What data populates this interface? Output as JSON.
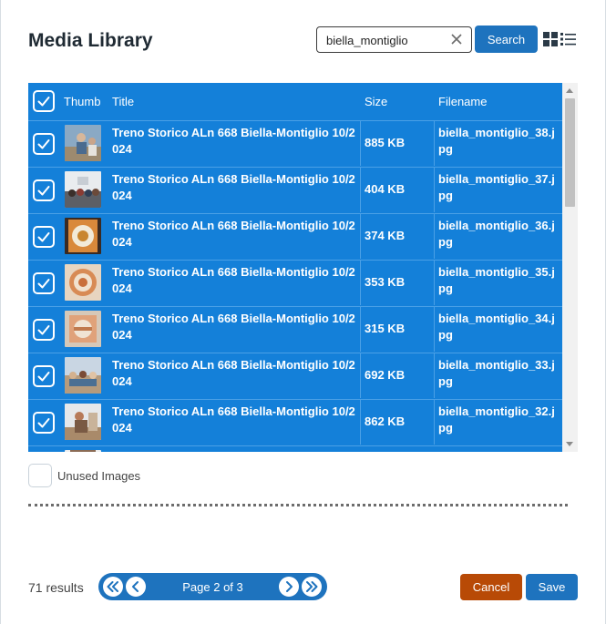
{
  "dialog": {
    "title": "Media Library"
  },
  "search": {
    "value": "biella_montiglio",
    "button_label": "Search"
  },
  "view_toggle": {
    "grid_icon": "grid-view-icon",
    "list_icon": "list-view-icon"
  },
  "table": {
    "columns": {
      "thumb": "Thumb",
      "title": "Title",
      "size": "Size",
      "filename": "Filename"
    },
    "select_all_checked": true,
    "rows": [
      {
        "checked": true,
        "title": "Treno Storico ALn 668 Biella-Montiglio 10/2024",
        "size": "885 KB",
        "filename": "biella_montiglio_38.jpg"
      },
      {
        "checked": true,
        "title": "Treno Storico ALn 668 Biella-Montiglio 10/2024",
        "size": "404 KB",
        "filename": "biella_montiglio_37.jpg"
      },
      {
        "checked": true,
        "title": "Treno Storico ALn 668 Biella-Montiglio 10/2024",
        "size": "374 KB",
        "filename": "biella_montiglio_36.jpg"
      },
      {
        "checked": true,
        "title": "Treno Storico ALn 668 Biella-Montiglio 10/2024",
        "size": "353 KB",
        "filename": "biella_montiglio_35.jpg"
      },
      {
        "checked": true,
        "title": "Treno Storico ALn 668 Biella-Montiglio 10/2024",
        "size": "315 KB",
        "filename": "biella_montiglio_34.jpg"
      },
      {
        "checked": true,
        "title": "Treno Storico ALn 668 Biella-Montiglio 10/2024",
        "size": "692 KB",
        "filename": "biella_montiglio_33.jpg"
      },
      {
        "checked": true,
        "title": "Treno Storico ALn 668 Biella-Montiglio 10/2024",
        "size": "862 KB",
        "filename": "biella_montiglio_32.jpg"
      }
    ]
  },
  "filters": {
    "unused_images_label": "Unused Images",
    "unused_images_checked": false
  },
  "footer": {
    "results": "71 results",
    "page_label": "Page 2 of 3",
    "cancel_label": "Cancel",
    "save_label": "Save"
  },
  "colors": {
    "primary": "#1e73be",
    "selected_row": "#1480d9",
    "cancel": "#b84a06"
  }
}
